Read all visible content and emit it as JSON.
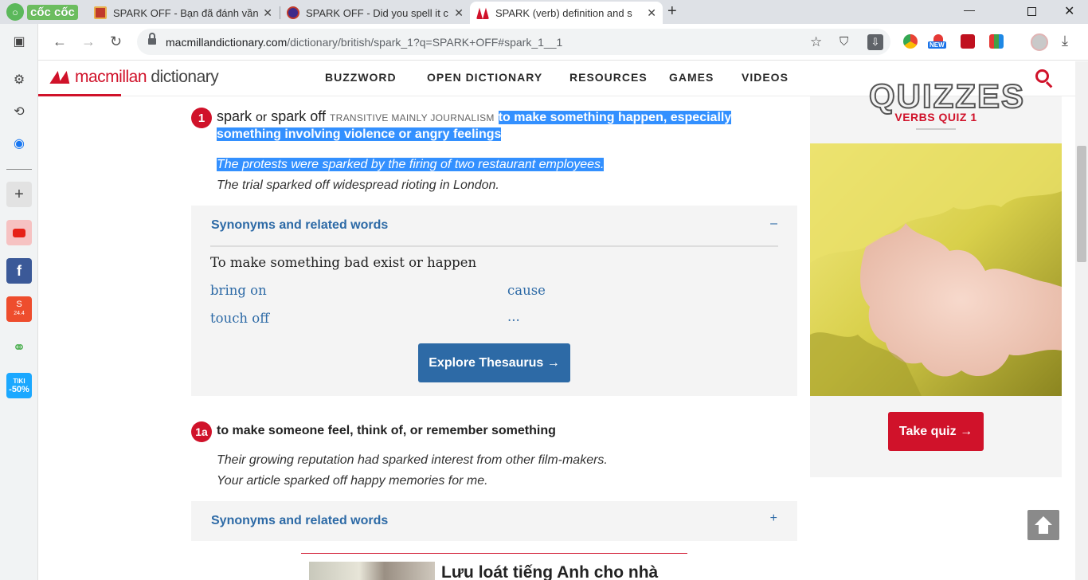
{
  "browser": {
    "brand": "cốc cốc",
    "tabs": [
      {
        "title": "SPARK OFF - Bạn đã đánh vần",
        "active": false
      },
      {
        "title": "SPARK OFF - Did you spell it c",
        "active": false
      },
      {
        "title": "SPARK (verb) definition and s",
        "active": true
      }
    ],
    "new_tab": "+",
    "url_host": "macmillandictionary.com",
    "url_path": "/dictionary/british/spark_1?q=SPARK+OFF#spark_1__1",
    "sidebar_badges": {
      "shopee": "24.4",
      "tiki_brand": "TIKI",
      "tiki_discount": "-50%"
    },
    "ext_new_label": "NEW"
  },
  "site": {
    "logo_mac": "macmillan",
    "logo_dict": " dictionary",
    "nav": [
      "BUZZWORD",
      "OPEN DICTIONARY",
      "RESOURCES",
      "GAMES",
      "VIDEOS"
    ]
  },
  "entry": {
    "sense1": {
      "number": "1",
      "headword": "spark",
      "or": "or",
      "variant": "spark off",
      "gram": "TRANSITIVE  MAINLY JOURNALISM",
      "definition": "to make something happen, especially something involving violence or angry feelings",
      "examples": [
        "The protests were sparked by the firing of two restaurant employees.",
        "The trial sparked off widespread rioting in London."
      ],
      "synonyms": {
        "header": "Synonyms and related words",
        "toggle": "–",
        "heading": "To make something bad exist or happen",
        "words": [
          "bring on",
          "cause",
          "touch off",
          "..."
        ],
        "button": "Explore Thesaurus →"
      }
    },
    "sense1a": {
      "number": "1a",
      "definition": "to make someone feel, think of, or remember something",
      "examples": [
        "Their growing reputation had sparked interest from other film-makers.",
        "Your article sparked off happy memories for me."
      ],
      "synonyms": {
        "header": "Synonyms and related words",
        "toggle": "+"
      }
    }
  },
  "promo": {
    "title": "Lưu loát tiếng Anh cho nhà"
  },
  "quiz": {
    "word": "QUIZZES",
    "title": "VERBS QUIZ 1",
    "button": "Take quiz →"
  },
  "colors": {
    "brand_red": "#d0122a",
    "link_blue": "#2d6aa6",
    "selection": "#3390ff"
  }
}
